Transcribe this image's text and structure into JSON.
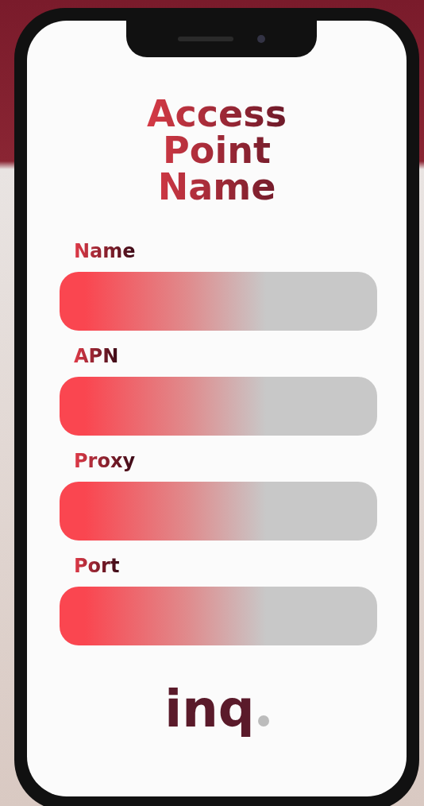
{
  "title": "Access Point Name",
  "fields": [
    {
      "label": "Name"
    },
    {
      "label": "APN"
    },
    {
      "label": "Proxy"
    },
    {
      "label": "Port"
    }
  ],
  "logo": {
    "text": "inq"
  }
}
